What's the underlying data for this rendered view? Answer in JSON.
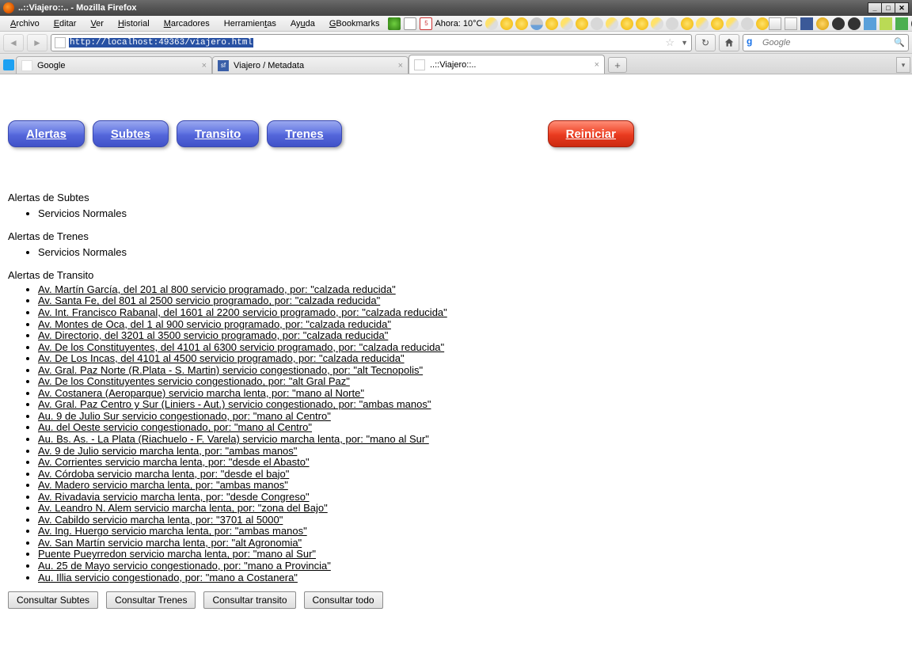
{
  "window": {
    "title": "..::Viajero::.. - Mozilla Firefox"
  },
  "menu": {
    "archivo": "Archivo",
    "editar": "Editar",
    "ver": "Ver",
    "historial": "Historial",
    "marcadores": "Marcadores",
    "herramientas": "Herramientas",
    "ayuda": "Ayuda",
    "gbookmarks": "GBookmarks"
  },
  "weather": {
    "label": "Ahora: 10°C"
  },
  "url": {
    "value": "http://localhost:49363/viajero.html",
    "search_placeholder": "Google"
  },
  "tabs": [
    {
      "label": "Google",
      "icon": "google"
    },
    {
      "label": "Viajero / Metadata",
      "icon": "sf"
    },
    {
      "label": "..::Viajero::..",
      "icon": "doc",
      "active": true
    }
  ],
  "nav_buttons": {
    "alertas": "Alertas",
    "subtes": "Subtes",
    "transito": "Transito",
    "trenes": "Trenes",
    "reiniciar": "Reiniciar"
  },
  "sections": {
    "subtes_title": "Alertas de Subtes",
    "subtes_items": [
      "Servicios Normales"
    ],
    "trenes_title": "Alertas de Trenes",
    "trenes_items": [
      "Servicios Normales"
    ],
    "transito_title": "Alertas de Transito",
    "transito_items": [
      "Av. Martín García, del 201 al 800 servicio programado, por: \"calzada reducida\"",
      "Av. Santa Fe, del 801 al 2500 servicio programado, por: \"calzada reducida\"",
      "Av. Int. Francisco Rabanal, del 1601 al 2200 servicio programado, por: \"calzada reducida\"",
      "Av. Montes de Oca, del 1 al 900 servicio programado, por: \"calzada reducida\"",
      "Av. Directorio, del 3201 al 3500 servicio programado, por: \"calzada reducida\"",
      "Av. De los Constituyentes, del 4101 al 6300 servicio programado, por: \"calzada reducida\"",
      "Av. De Los Incas, del 4101 al 4500 servicio programado, por: \"calzada reducida\"",
      "Av. Gral. Paz Norte (R.Plata - S. Martin) servicio congestionado, por: \"alt Tecnopolis\"",
      "Av. De los Constituyentes servicio congestionado, por: \"alt Gral Paz\"",
      "Av. Costanera (Aeroparque) servicio marcha lenta, por: \"mano al Norte\"",
      "Av. Gral. Paz Centro y Sur (Liniers - Aut.) servicio congestionado, por: \"ambas manos\"",
      "Au. 9 de Julio Sur servicio congestionado, por: \"mano al Centro\"",
      "Au. del Oeste servicio congestionado, por: \"mano al Centro\"",
      "Au. Bs. As. - La Plata (Riachuelo - F. Varela) servicio marcha lenta, por: \"mano al Sur\"",
      "Av. 9 de Julio servicio marcha lenta, por: \"ambas manos\"",
      "Av. Corrientes servicio marcha lenta, por: \"desde el Abasto\"",
      "Av. Córdoba servicio marcha lenta, por: \"desde el bajo\"",
      "Av. Madero servicio marcha lenta, por: \"ambas manos\"",
      "Av. Rivadavia servicio marcha lenta, por: \"desde Congreso\"",
      "Av. Leandro N. Alem servicio marcha lenta, por: \"zona del Bajo\"",
      "Av. Cabildo servicio marcha lenta, por: \"3701 al 5000\"",
      "Av. Ing. Huergo servicio marcha lenta, por: \"ambas manos\"",
      "Av. San Martín servicio marcha lenta, por: \"alt Agronomia\"",
      "Puente Pueyrredon servicio marcha lenta, por: \"mano al Sur\"",
      "Au. 25 de Mayo servicio congestionado, por: \"mano a Provincia\"",
      "Au. Illia servicio congestionado, por: \"mano a Costanera\""
    ]
  },
  "consult": {
    "subtes": "Consultar Subtes",
    "trenes": "Consultar Trenes",
    "transito": "Consultar transito",
    "todo": "Consultar todo"
  }
}
